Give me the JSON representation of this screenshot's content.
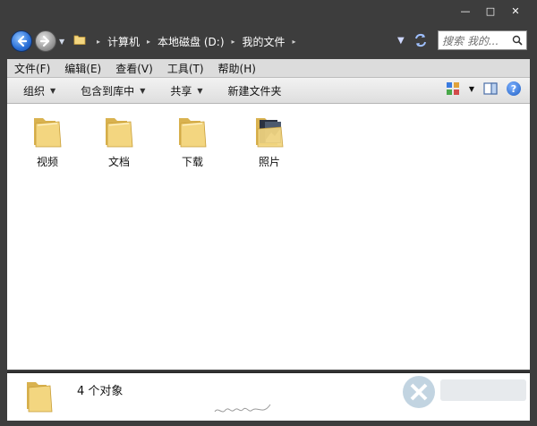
{
  "caption": {
    "minimize_glyph": "—",
    "maximize_glyph": "□",
    "close_glyph": "✕"
  },
  "nav": {
    "back_icon": "back-arrow-icon",
    "forward_icon": "forward-arrow-icon",
    "history_drop": "▼"
  },
  "breadcrumbs": [
    "计算机",
    "本地磁盘 (D:)",
    "我的文件"
  ],
  "breadcrumb_sep": "▸",
  "address_drop": "▼",
  "search": {
    "placeholder": "搜索 我的..."
  },
  "menu": [
    "文件(F)",
    "编辑(E)",
    "查看(V)",
    "工具(T)",
    "帮助(H)"
  ],
  "commands": {
    "organize": "组织",
    "include_library": "包含到库中",
    "share": "共享",
    "new_folder": "新建文件夹",
    "drop": "▼"
  },
  "help_glyph": "?",
  "files": [
    {
      "name": "视频",
      "icon": "folder-icon"
    },
    {
      "name": "文档",
      "icon": "folder-icon"
    },
    {
      "name": "下载",
      "icon": "folder-icon"
    },
    {
      "name": "照片",
      "icon": "folder-with-photos-icon"
    }
  ],
  "status": {
    "text": "4 个对象"
  },
  "colors": {
    "folder": "#f3d680",
    "folder_dark": "#d9b24f",
    "window": "#3d3d3d",
    "accent": "#2a6fd6"
  }
}
